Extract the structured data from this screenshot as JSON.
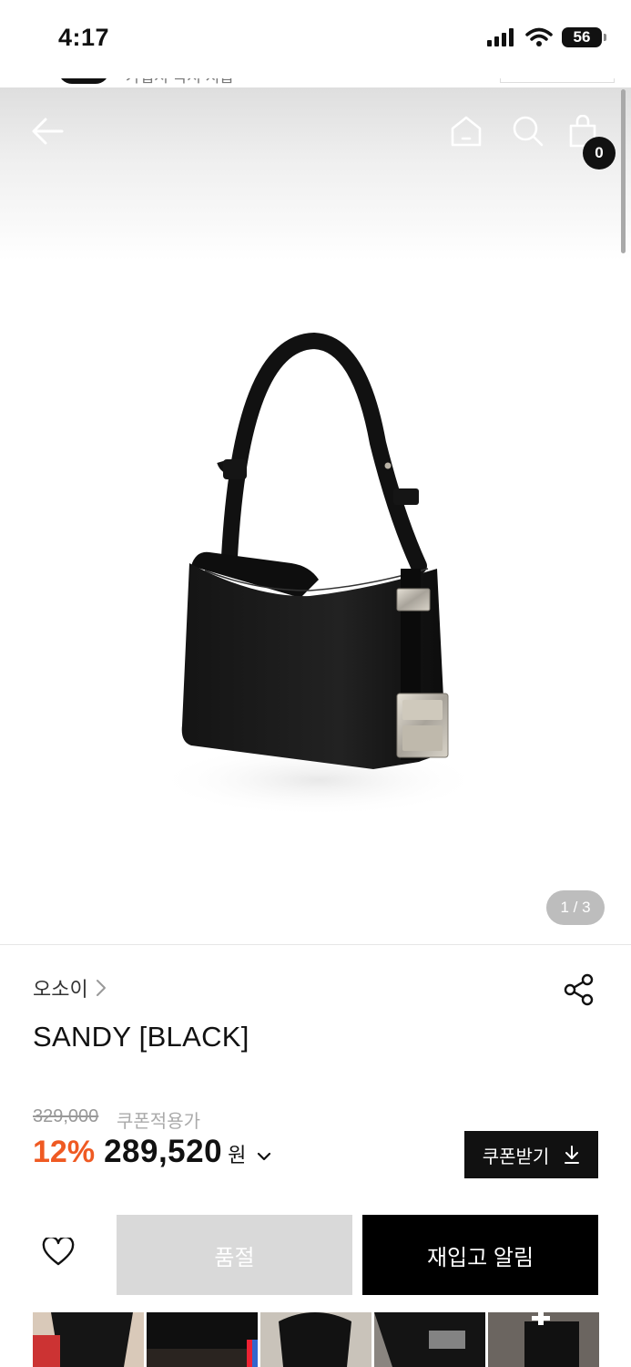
{
  "status_bar": {
    "time": "4:17",
    "battery": "56"
  },
  "peek": {
    "text": "가입시 즉시 지급"
  },
  "nav": {
    "cart_count": "0"
  },
  "gallery": {
    "counter": "1 / 3"
  },
  "product": {
    "brand": "오소이",
    "name": "SANDY [BLACK]",
    "original_price": "329,000",
    "coupon_note": "쿠폰적용가",
    "discount": "12%",
    "price": "289,520",
    "currency": "원",
    "coupon_button": "쿠폰받기"
  },
  "actions": {
    "soldout_label": "품절",
    "restock_label": "재입고 알림"
  },
  "colors": {
    "accent_discount": "#ef5a23",
    "primary_button": "#000000",
    "disabled_button": "#d9d9d9"
  },
  "icons": [
    "back-arrow-icon",
    "home-icon",
    "search-icon",
    "shopping-bag-icon",
    "share-icon",
    "heart-icon",
    "download-icon",
    "chevron-down-icon",
    "chevron-right-icon"
  ]
}
